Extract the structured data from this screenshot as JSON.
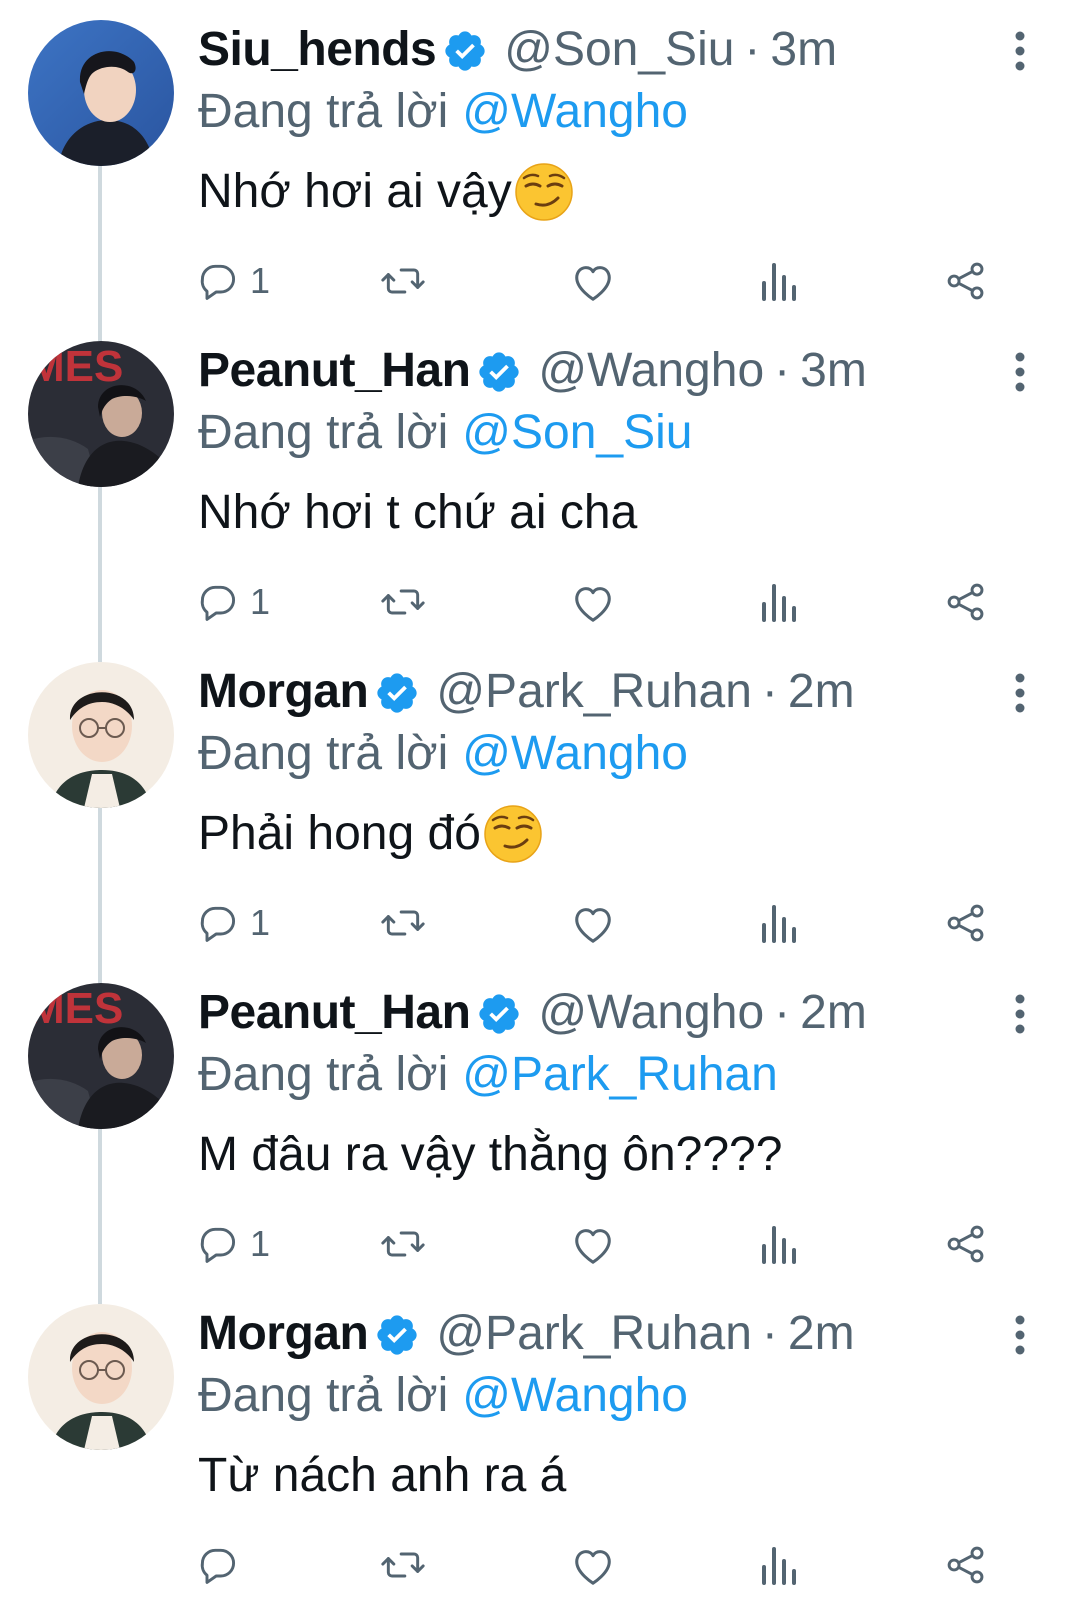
{
  "thread": {
    "reply_prefix": "Đang trả lời",
    "separator": "·",
    "colors": {
      "text": "#0f1419",
      "secondary": "#536471",
      "accent": "#1d9bf0",
      "thread_line": "#cfd9de"
    },
    "tweets": [
      {
        "display_name": "Siu_hends",
        "handle": "@Son_Siu",
        "time": "3m",
        "reply_to": "@Wangho",
        "text": "Nhớ hơi ai vậy",
        "emoji": "smirking-face",
        "reply_count": "1",
        "avatar": "avatar-siu",
        "verified": true
      },
      {
        "display_name": "Peanut_Han",
        "handle": "@Wangho",
        "time": "3m",
        "reply_to": "@Son_Siu",
        "text": "Nhớ hơi t chứ ai cha",
        "emoji": "",
        "reply_count": "1",
        "avatar": "avatar-peanut",
        "verified": true
      },
      {
        "display_name": "Morgan",
        "handle": "@Park_Ruhan",
        "time": "2m",
        "reply_to": "@Wangho",
        "text": "Phải hong đó",
        "emoji": "smirking-face",
        "reply_count": "1",
        "avatar": "avatar-morgan",
        "verified": true
      },
      {
        "display_name": "Peanut_Han",
        "handle": "@Wangho",
        "time": "2m",
        "reply_to": "@Park_Ruhan",
        "text": "M đâu ra vậy thằng ôn????",
        "emoji": "",
        "reply_count": "1",
        "avatar": "avatar-peanut",
        "verified": true
      },
      {
        "display_name": "Morgan",
        "handle": "@Park_Ruhan",
        "time": "2m",
        "reply_to": "@Wangho",
        "text": "Từ nách anh ra á",
        "emoji": "",
        "reply_count": "",
        "avatar": "avatar-morgan",
        "verified": true
      }
    ],
    "icons": {
      "reply": "reply-icon",
      "retweet": "retweet-icon",
      "like": "heart-icon",
      "views": "views-icon",
      "share": "share-icon",
      "more": "more-vertical-icon",
      "verified": "verified-badge-icon"
    }
  }
}
